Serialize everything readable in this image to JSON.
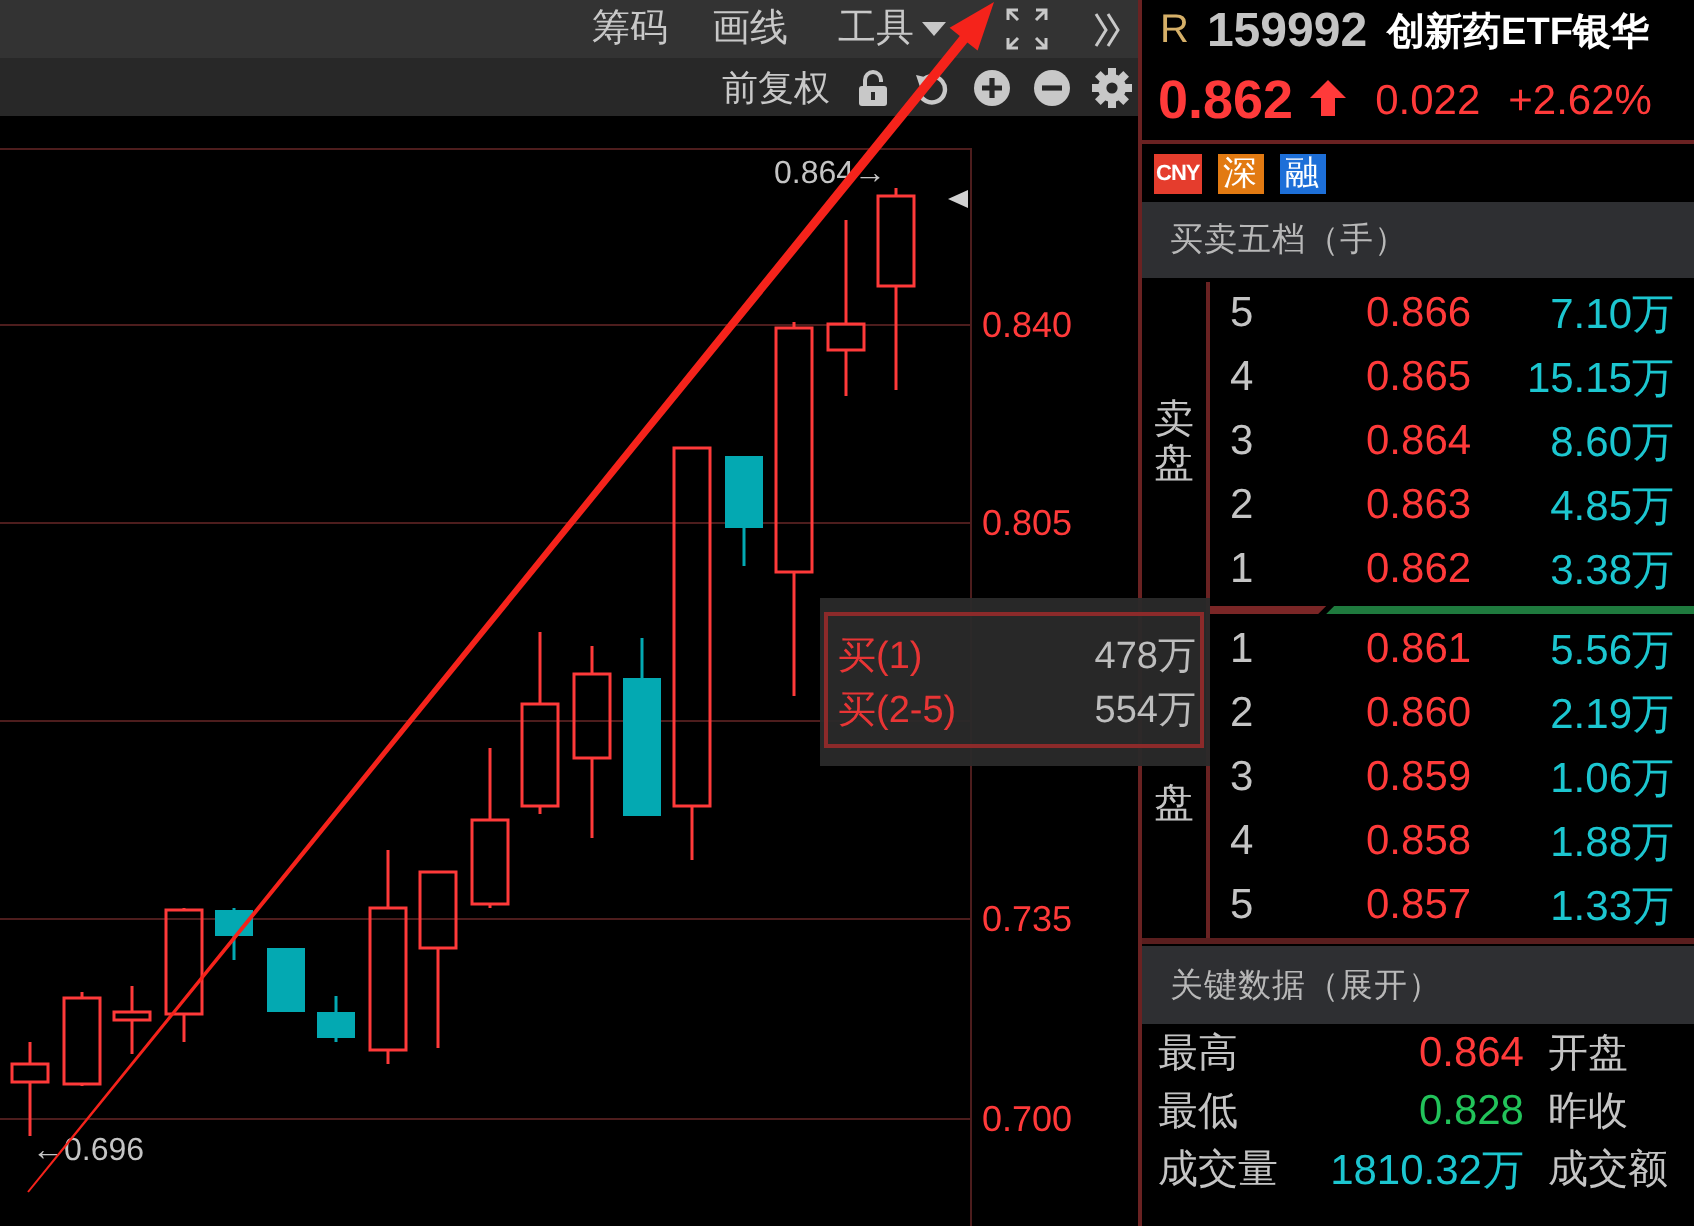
{
  "toolbar": {
    "buttons": [
      "筹码",
      "画线"
    ],
    "dropdown": "工具"
  },
  "chart_toolbar": {
    "adjust_button": "前复权"
  },
  "chart": {
    "price_labels": [
      "0.840",
      "0.805",
      "0.735",
      "0.700"
    ],
    "high_label": "0.864→",
    "low_label": "←0.696"
  },
  "tooltip": {
    "rows": [
      {
        "label": "买(1)",
        "value": "478万"
      },
      {
        "label": "买(2-5)",
        "value": "554万"
      }
    ]
  },
  "quote": {
    "market": "R",
    "code": "159992",
    "name": "创新药ETF银华",
    "price": "0.862",
    "rising": true,
    "change": "0.022",
    "change_pct": "+2.62%"
  },
  "badges": [
    {
      "text": "CNY",
      "kind": "abbr",
      "color": "#e53d2d"
    },
    {
      "text": "深",
      "kind": "glyph",
      "color": "#e27a12"
    },
    {
      "text": "融",
      "kind": "glyph",
      "color": "#1d6fd8"
    }
  ],
  "order_book": {
    "title": "买卖五档（手）",
    "asks": {
      "label": "卖盘",
      "rows": [
        {
          "rank": "5",
          "price": "0.866",
          "volume": "7.10万"
        },
        {
          "rank": "4",
          "price": "0.865",
          "volume": "15.15万"
        },
        {
          "rank": "3",
          "price": "0.864",
          "volume": "8.60万"
        },
        {
          "rank": "2",
          "price": "0.863",
          "volume": "4.85万"
        },
        {
          "rank": "1",
          "price": "0.862",
          "volume": "3.38万"
        }
      ]
    },
    "balance_bar": {
      "level": 0.24
    },
    "bids": {
      "label": "盘",
      "rows": [
        {
          "rank": "1",
          "price": "0.861",
          "volume": "5.56万"
        },
        {
          "rank": "2",
          "price": "0.860",
          "volume": "2.19万"
        },
        {
          "rank": "3",
          "price": "0.859",
          "volume": "1.06万"
        },
        {
          "rank": "4",
          "price": "0.858",
          "volume": "1.88万"
        },
        {
          "rank": "5",
          "price": "0.857",
          "volume": "1.33万"
        }
      ]
    }
  },
  "key_data": {
    "title": "关键数据（展开）",
    "rows": [
      {
        "label": "最高",
        "value": "0.864",
        "color": "#ff3a3a",
        "label_2": "开盘"
      },
      {
        "label": "最低",
        "value": "0.828",
        "color": "#22c35a",
        "label_2": "昨收"
      },
      {
        "label": "成交量",
        "value": "1810.32万",
        "color": "#1cc6d0",
        "label_2": "成交额"
      }
    ]
  }
}
